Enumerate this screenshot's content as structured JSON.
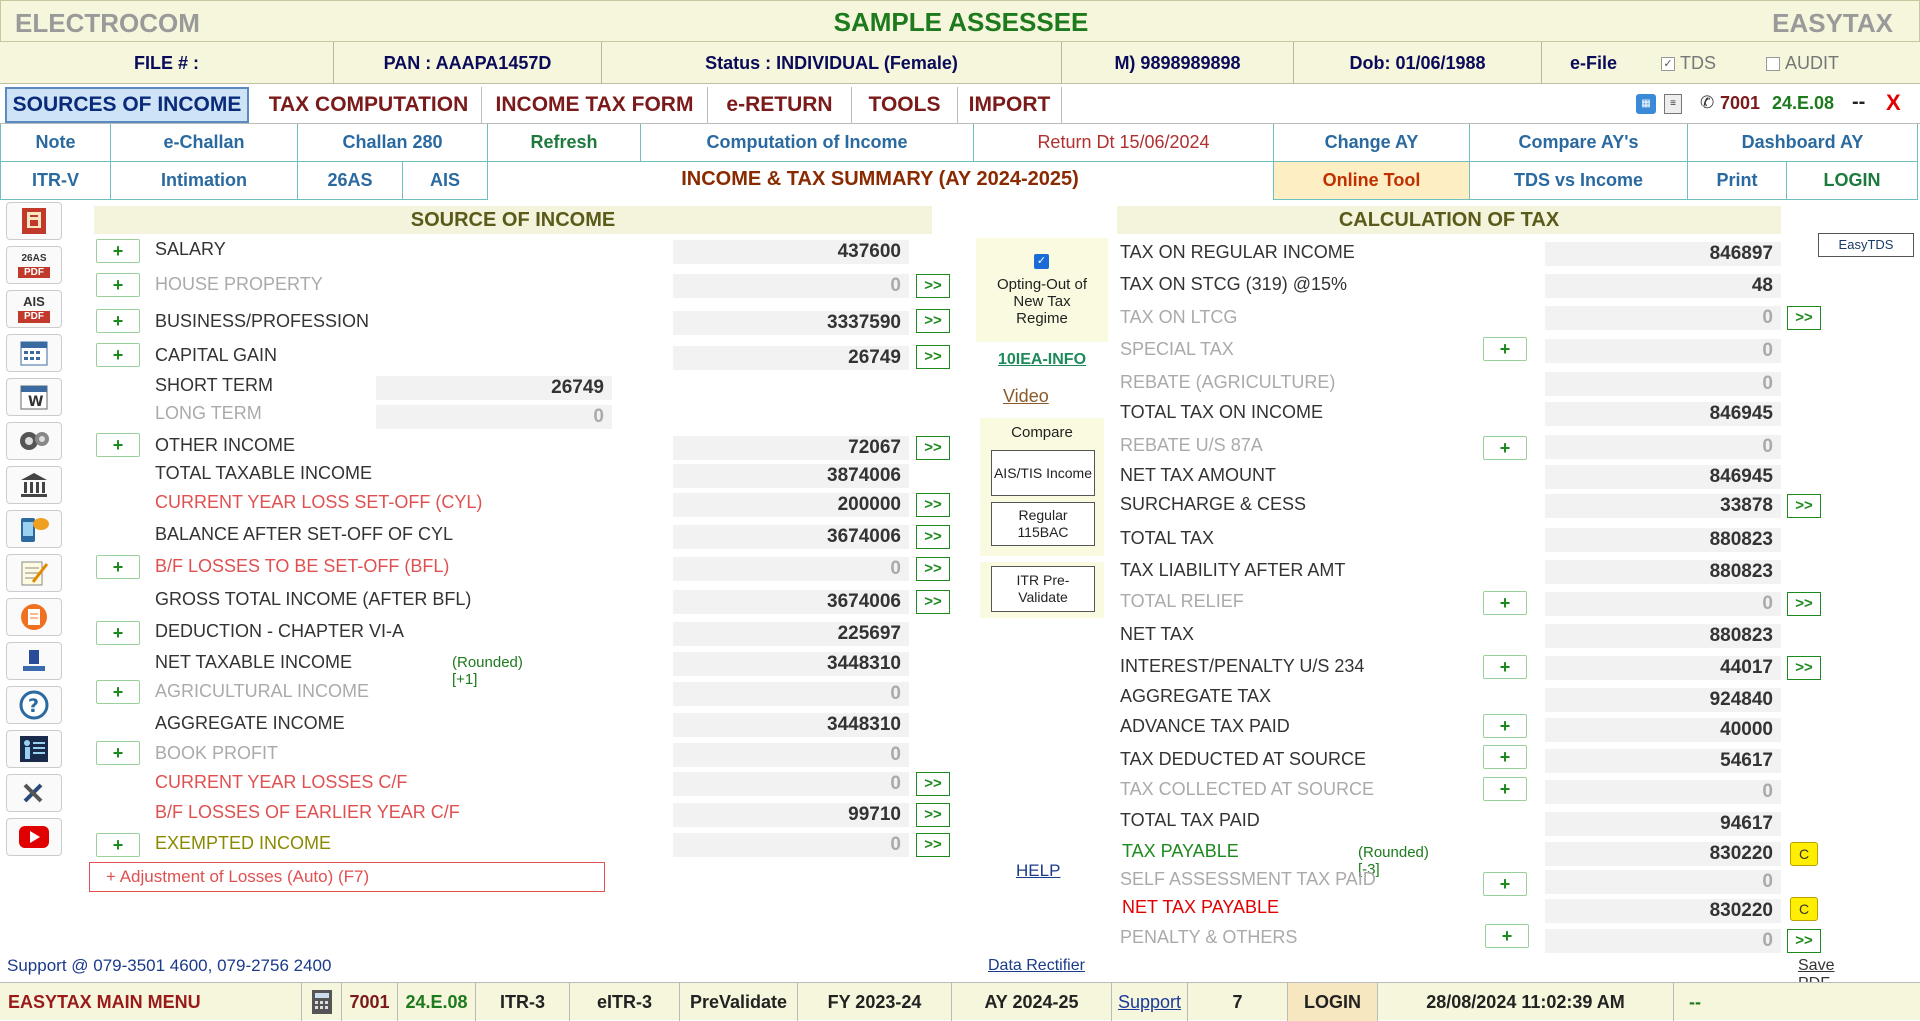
{
  "app": {
    "brand_left": "ELECTROCOM",
    "title": "SAMPLE ASSESSEE",
    "brand_right": "EASYTAX"
  },
  "info": {
    "file": "FILE # :",
    "pan": "PAN : AAAPA1457D",
    "status": "Status : INDIVIDUAL (Female)",
    "mobile": "M) 9898989898",
    "dob": "Dob: 01/06/1988",
    "efile": "e-File",
    "tds": "TDS",
    "audit": "AUDIT"
  },
  "menu": {
    "tabs": [
      "SOURCES OF INCOME",
      "TAX COMPUTATION",
      "INCOME TAX FORM",
      "e-RETURN",
      "TOOLS",
      "IMPORT"
    ],
    "phone_code": "7001",
    "version": "24.E.08",
    "dash": "--",
    "close": "X"
  },
  "toolbar1": [
    "Note",
    "e-Challan",
    "Challan 280",
    "Refresh",
    "Computation of Income",
    "Return Dt 15/06/2024",
    "Change AY",
    "Compare AY's",
    "Dashboard AY"
  ],
  "toolbar2": [
    "ITR-V",
    "Intimation",
    "26AS",
    "AIS",
    "Online Tool",
    "TDS vs Income",
    "Print",
    "LOGIN"
  ],
  "summary_title": "INCOME & TAX SUMMARY (AY 2024-2025)",
  "left_icons": [
    "form-icon",
    "26as-pdf-icon",
    "ais-pdf-icon",
    "calendar-icon",
    "calendar2-icon",
    "gears-icon",
    "bank-icon",
    "phone-chat-icon",
    "notepad-icon",
    "clipboard-icon",
    "company-info-icon",
    "help-icon",
    "presenter-icon",
    "tools-icon",
    "youtube-icon"
  ],
  "left_icon_labels": {
    "26as": "26AS",
    "pdf": "PDF",
    "ais": "AIS"
  },
  "source": {
    "heading": "SOURCE OF INCOME",
    "rows": [
      {
        "label": "SALARY",
        "value": "437600"
      },
      {
        "label": "HOUSE PROPERTY",
        "value": "0"
      },
      {
        "label": "BUSINESS/PROFESSION",
        "value": "3337590"
      },
      {
        "label": "CAPITAL GAIN",
        "value": "26749"
      },
      {
        "label": "SHORT TERM",
        "value": "26749"
      },
      {
        "label": "LONG TERM",
        "value": "0"
      },
      {
        "label": "OTHER INCOME",
        "value": "72067"
      },
      {
        "label": "TOTAL TAXABLE INCOME",
        "value": "3874006"
      },
      {
        "label": "CURRENT YEAR LOSS SET-OFF (CYL)",
        "value": "200000"
      },
      {
        "label": "BALANCE AFTER SET-OFF OF CYL",
        "value": "3674006"
      },
      {
        "label": "B/F LOSSES TO BE SET-OFF (BFL)",
        "value": "0"
      },
      {
        "label": "GROSS TOTAL INCOME (AFTER BFL)",
        "value": "3674006"
      },
      {
        "label": "DEDUCTION - CHAPTER VI-A",
        "value": "225697"
      },
      {
        "label": "NET TAXABLE INCOME",
        "value": "3448310",
        "note": "(Rounded) [+1]"
      },
      {
        "label": "AGRICULTURAL INCOME",
        "value": "0"
      },
      {
        "label": "AGGREGATE INCOME",
        "value": "3448310"
      },
      {
        "label": "BOOK PROFIT",
        "value": "0"
      },
      {
        "label": "CURRENT YEAR LOSSES C/F",
        "value": "0"
      },
      {
        "label": "B/F LOSSES OF EARLIER YEAR C/F",
        "value": "99710"
      },
      {
        "label": "EXEMPTED INCOME",
        "value": "0"
      }
    ],
    "adjust": "+   Adjustment of Losses (Auto) (F7)"
  },
  "plus_sign": "+",
  "arrow_sign": ">>",
  "c_sign": "C",
  "middle": {
    "optout": "Opting-Out of New Tax Regime",
    "info_link": "10IEA-INFO",
    "video": "Video",
    "compare": "Compare",
    "ais_tis": "AIS/TIS Income",
    "regular": "Regular 115BAC",
    "itr_pre": "ITR Pre-Validate",
    "help": "HELP",
    "data_rectifier": "Data Rectifier"
  },
  "calc": {
    "heading": "CALCULATION OF TAX",
    "easytds": "EasyTDS",
    "rows": [
      {
        "label": "TAX ON REGULAR INCOME",
        "value": "846897"
      },
      {
        "label": "TAX ON STCG (319) @15%",
        "value": "48"
      },
      {
        "label": "TAX ON LTCG",
        "value": "0"
      },
      {
        "label": "SPECIAL TAX",
        "value": "0"
      },
      {
        "label": "REBATE (AGRICULTURE)",
        "value": "0"
      },
      {
        "label": "TOTAL TAX ON INCOME",
        "value": "846945"
      },
      {
        "label": "REBATE U/S 87A",
        "value": "0"
      },
      {
        "label": "NET TAX AMOUNT",
        "value": "846945"
      },
      {
        "label": "SURCHARGE & CESS",
        "value": "33878"
      },
      {
        "label": "TOTAL TAX",
        "value": "880823"
      },
      {
        "label": "TAX LIABILITY AFTER AMT",
        "value": "880823"
      },
      {
        "label": "TOTAL RELIEF",
        "value": "0"
      },
      {
        "label": "NET TAX",
        "value": "880823"
      },
      {
        "label": "INTEREST/PENALTY U/S 234",
        "value": "44017"
      },
      {
        "label": "AGGREGATE TAX",
        "value": "924840"
      },
      {
        "label": "ADVANCE TAX PAID",
        "value": "40000"
      },
      {
        "label": "TAX DEDUCTED AT SOURCE",
        "value": "54617"
      },
      {
        "label": "TAX COLLECTED AT SOURCE",
        "value": "0"
      },
      {
        "label": "TOTAL TAX PAID",
        "value": "94617"
      },
      {
        "label": "TAX PAYABLE",
        "value": "830220",
        "note": "(Rounded) [-3]"
      },
      {
        "label": "SELF ASSESSMENT TAX PAID",
        "value": "0"
      },
      {
        "label": "NET TAX PAYABLE",
        "value": "830220"
      },
      {
        "label": "PENALTY & OTHERS",
        "value": "0"
      }
    ],
    "save_pdf": "Save PDF"
  },
  "support": "Support @ 079-3501 4600, 079-2756 2400",
  "status": {
    "menu": "EASYTAX MAIN MENU",
    "code": "7001",
    "version": "24.E.08",
    "itr": "ITR-3",
    "eitr": "eITR-3",
    "prevalidate": "PreValidate",
    "fy": "FY 2023-24",
    "ay": "AY 2024-25",
    "support": "Support",
    "num": "7",
    "login": "LOGIN",
    "datetime": "28/08/2024 11:02:39 AM",
    "dash": "--"
  },
  "colors": {
    "accent_green": "#1d7a1d",
    "header_bg": "#f6f6dc",
    "tab_active": "#cfe3f7",
    "warn_yellow": "#ffee00"
  }
}
